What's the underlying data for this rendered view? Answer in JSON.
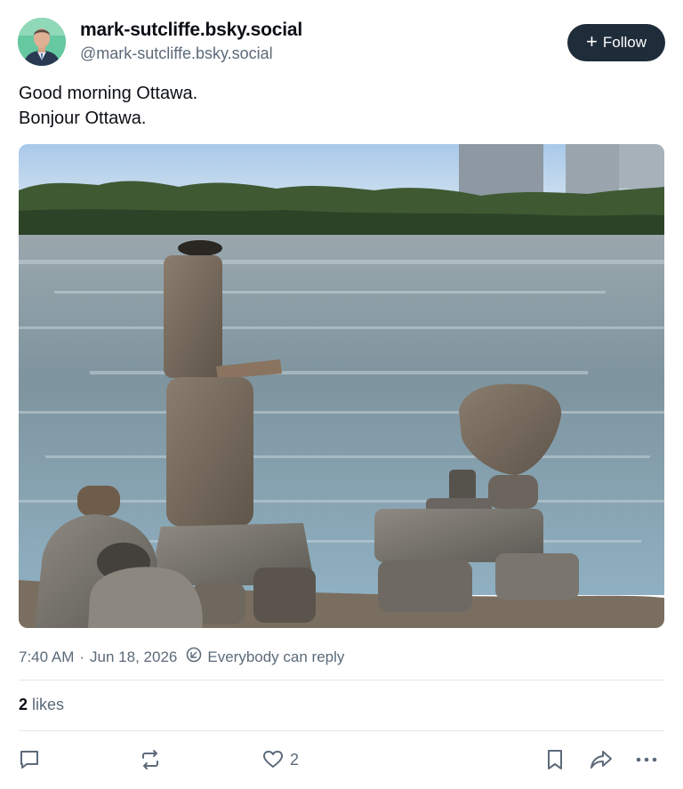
{
  "author": {
    "display_name": "mark-sutcliffe.bsky.social",
    "handle": "@mark-sutcliffe.bsky.social"
  },
  "follow": {
    "label": "Follow",
    "icon": "plus-icon"
  },
  "post": {
    "lines": [
      "Good morning Ottawa.",
      "Bonjour Ottawa."
    ],
    "image_subject": "photo"
  },
  "meta": {
    "time": "7:40 AM",
    "separator": "·",
    "date": "Jun 18, 2026",
    "reply_setting": "Everybody can reply"
  },
  "likes": {
    "count": "2",
    "label": "likes"
  },
  "actions": {
    "reply_icon": "comment-icon",
    "repost_icon": "repost-icon",
    "like_icon": "heart-icon",
    "like_count": "2",
    "bookmark_icon": "bookmark-icon",
    "share_icon": "share-icon",
    "more_icon": "more-icon"
  },
  "colors": {
    "follow_bg": "#1f2c3a",
    "secondary_text": "#5c6a79",
    "divider": "#e2e7ec"
  }
}
